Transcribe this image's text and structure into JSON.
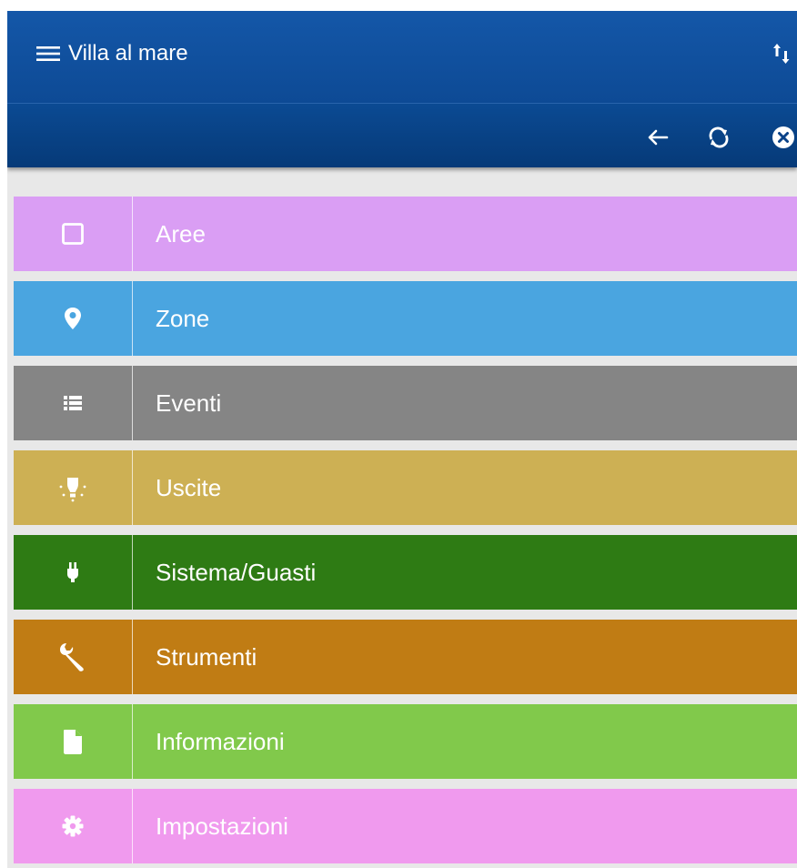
{
  "header": {
    "title": "Villa al mare",
    "menu_icon": "hamburger-menu-icon",
    "sort_icon": "sort-arrows-icon"
  },
  "toolbar": {
    "back_icon": "arrow-left-icon",
    "refresh_icon": "refresh-icon",
    "close_icon": "close-circle-icon"
  },
  "menu": {
    "items": [
      {
        "label": "Aree",
        "icon": "square-outline-icon",
        "color": "#da9ef4"
      },
      {
        "label": "Zone",
        "icon": "map-marker-icon",
        "color": "#4aa5e0"
      },
      {
        "label": "Eventi",
        "icon": "list-icon",
        "color": "#858585"
      },
      {
        "label": "Uscite",
        "icon": "lightbulb-icon",
        "color": "#cdb054"
      },
      {
        "label": "Sistema/Guasti",
        "icon": "plug-icon",
        "color": "#2e7b14"
      },
      {
        "label": "Strumenti",
        "icon": "wrench-icon",
        "color": "#c07c14"
      },
      {
        "label": "Informazioni",
        "icon": "document-icon",
        "color": "#81c94b"
      },
      {
        "label": "Impostazioni",
        "icon": "gear-icon",
        "color": "#f09aee"
      }
    ]
  }
}
